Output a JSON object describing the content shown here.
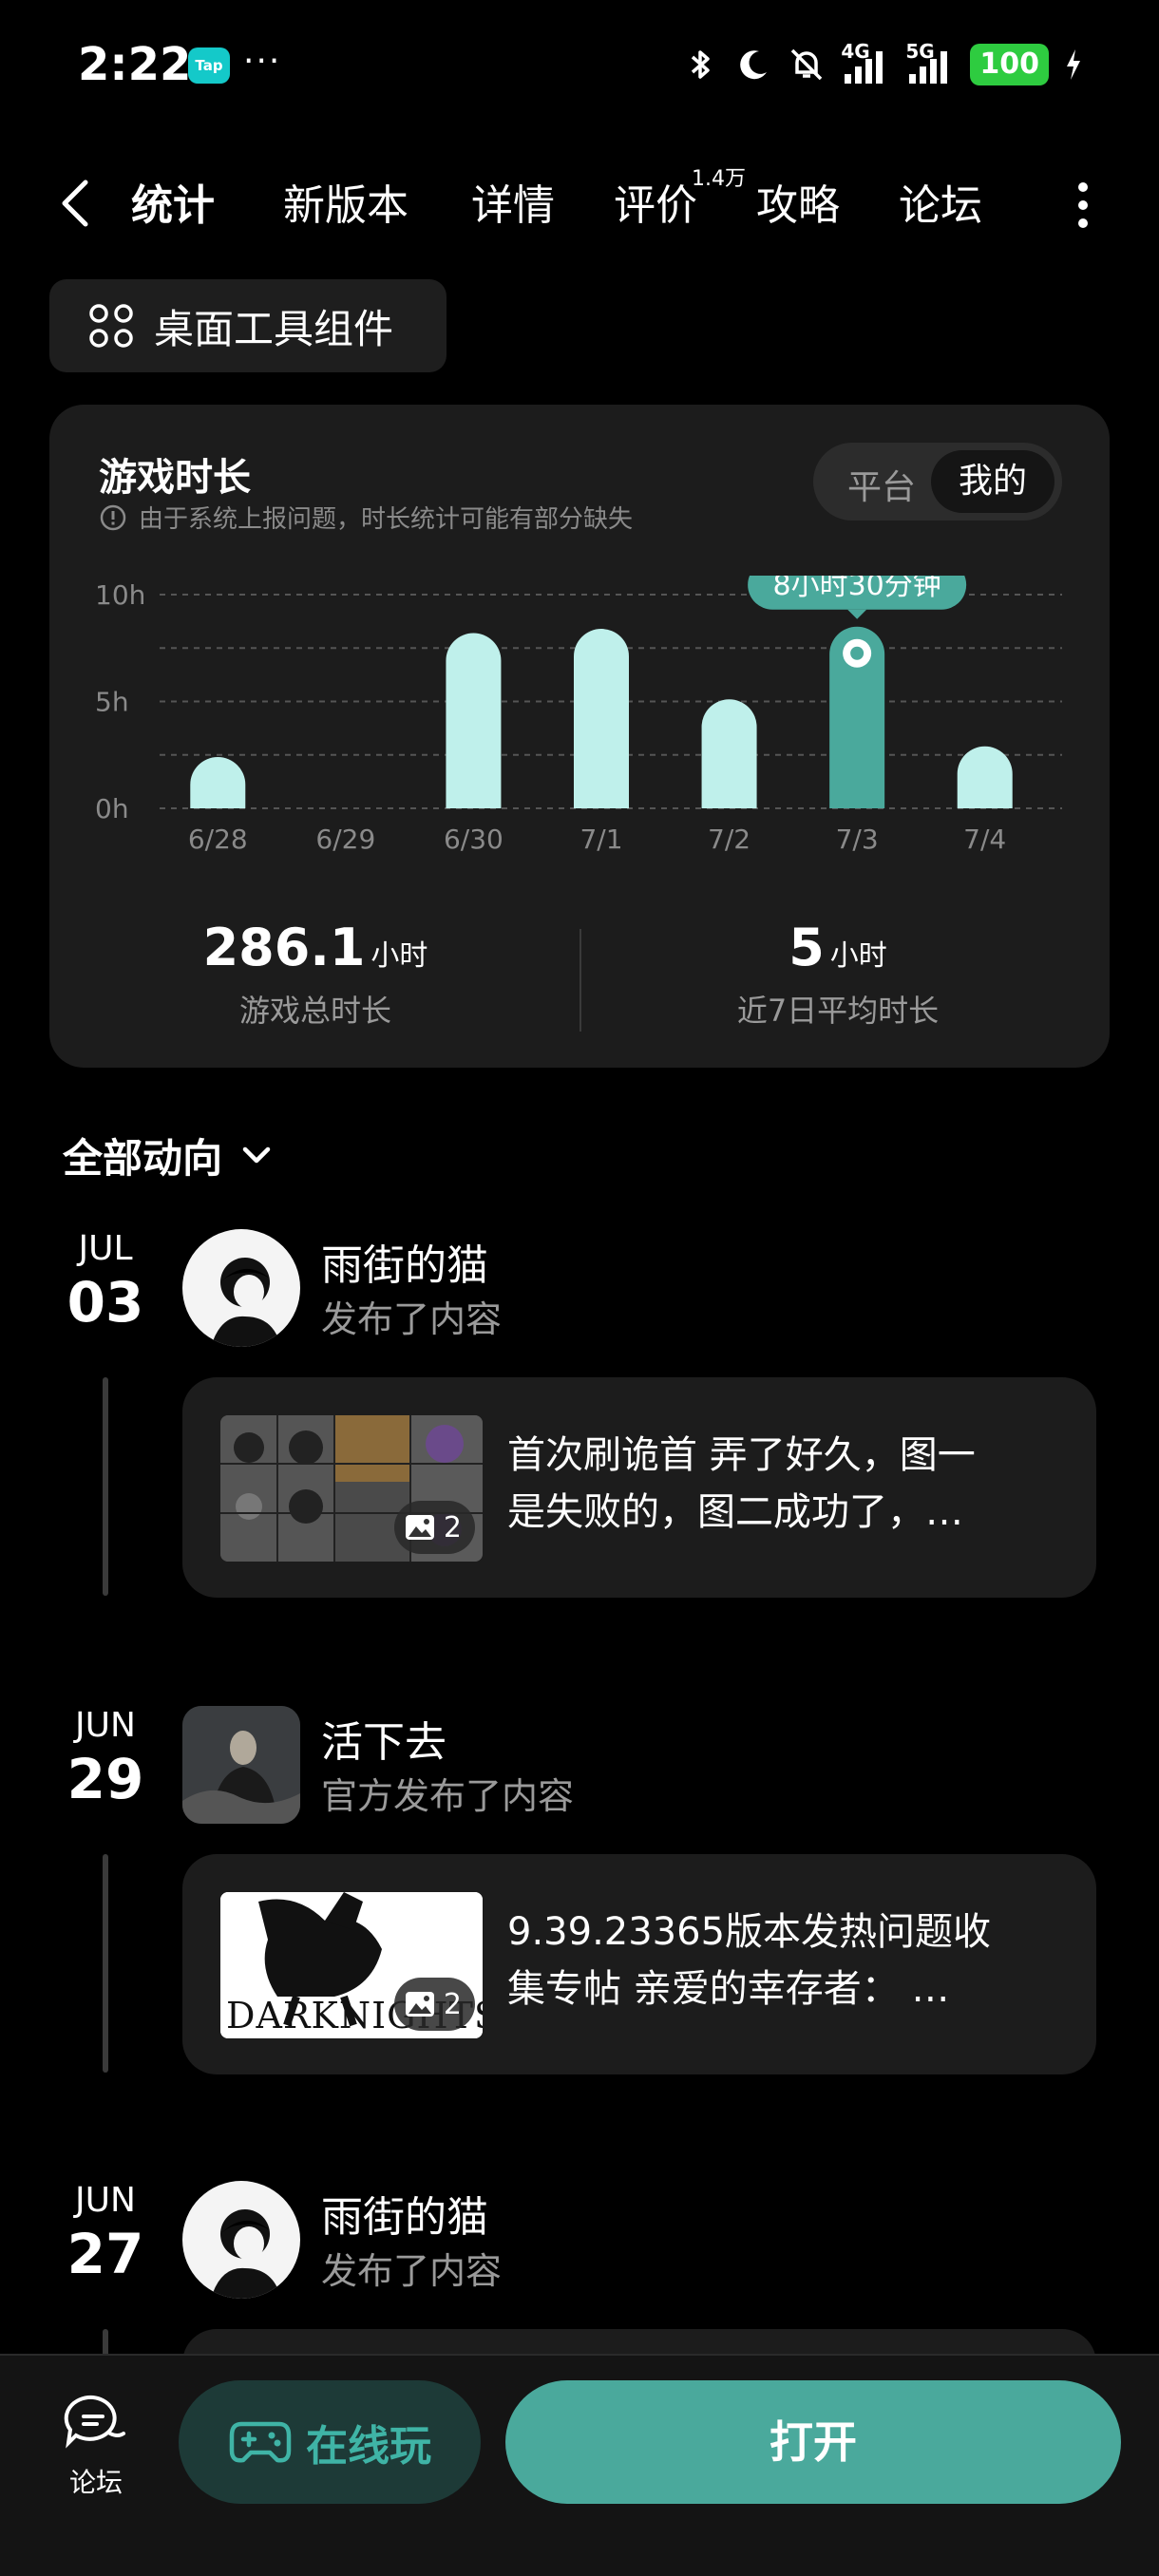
{
  "status_bar": {
    "time": "2:22",
    "app_badge": "Tap",
    "more": "···",
    "network1": "4G",
    "network2": "5G",
    "battery": "100"
  },
  "tabs": {
    "items": [
      "统计",
      "新版本",
      "详情",
      "评价",
      "攻略",
      "论坛"
    ],
    "active": "统计",
    "review_count": "1.4万"
  },
  "widget_button": {
    "label": "桌面工具组件"
  },
  "stats_card": {
    "title": "游戏时长",
    "note": "由于系统上报问题，时长统计可能有部分缺失",
    "toggle": {
      "option1": "平台",
      "option2": "我的",
      "selected": "我的"
    },
    "tooltip": "8小时30分钟",
    "total": {
      "value": "286.1",
      "unit": "小时",
      "label": "游戏总时长"
    },
    "average": {
      "value": "5",
      "unit": "小时",
      "label": "近7日平均时长"
    }
  },
  "chart_data": {
    "type": "bar",
    "categories": [
      "6/28",
      "6/29",
      "6/30",
      "7/1",
      "7/2",
      "7/3",
      "7/4"
    ],
    "values": [
      2.4,
      0,
      8.2,
      8.4,
      5.1,
      8.5,
      2.9
    ],
    "highlighted": "7/3",
    "ylim": [
      0,
      10
    ],
    "yticks": [
      "0h",
      "5h",
      "10h"
    ],
    "grid": true,
    "colors": {
      "bar": "#bff0eb",
      "highlight": "#4aa99c"
    }
  },
  "feed": {
    "filter_label": "全部动向",
    "items": [
      {
        "month": "JUL",
        "day": "03",
        "user": "雨街的猫",
        "action": "发布了内容",
        "image_count": "2",
        "text_line1": "首次刷诡首 弄了好久，图一",
        "text_line2": "是失败的，图二成功了，…"
      },
      {
        "month": "JUN",
        "day": "29",
        "user": "活下去",
        "action": "官方发布了内容",
        "image_count": "2",
        "thumb_text": "DARKNIGHTS",
        "text_line1": "9.39.23365版本发热问题收",
        "text_line2": "集专帖 亲爱的幸存者：  …"
      },
      {
        "month": "JUN",
        "day": "27",
        "user": "雨街的猫",
        "action": "发布了内容"
      }
    ]
  },
  "bottom_bar": {
    "forum_label": "论坛",
    "play_label": "在线玩",
    "open_label": "打开"
  }
}
